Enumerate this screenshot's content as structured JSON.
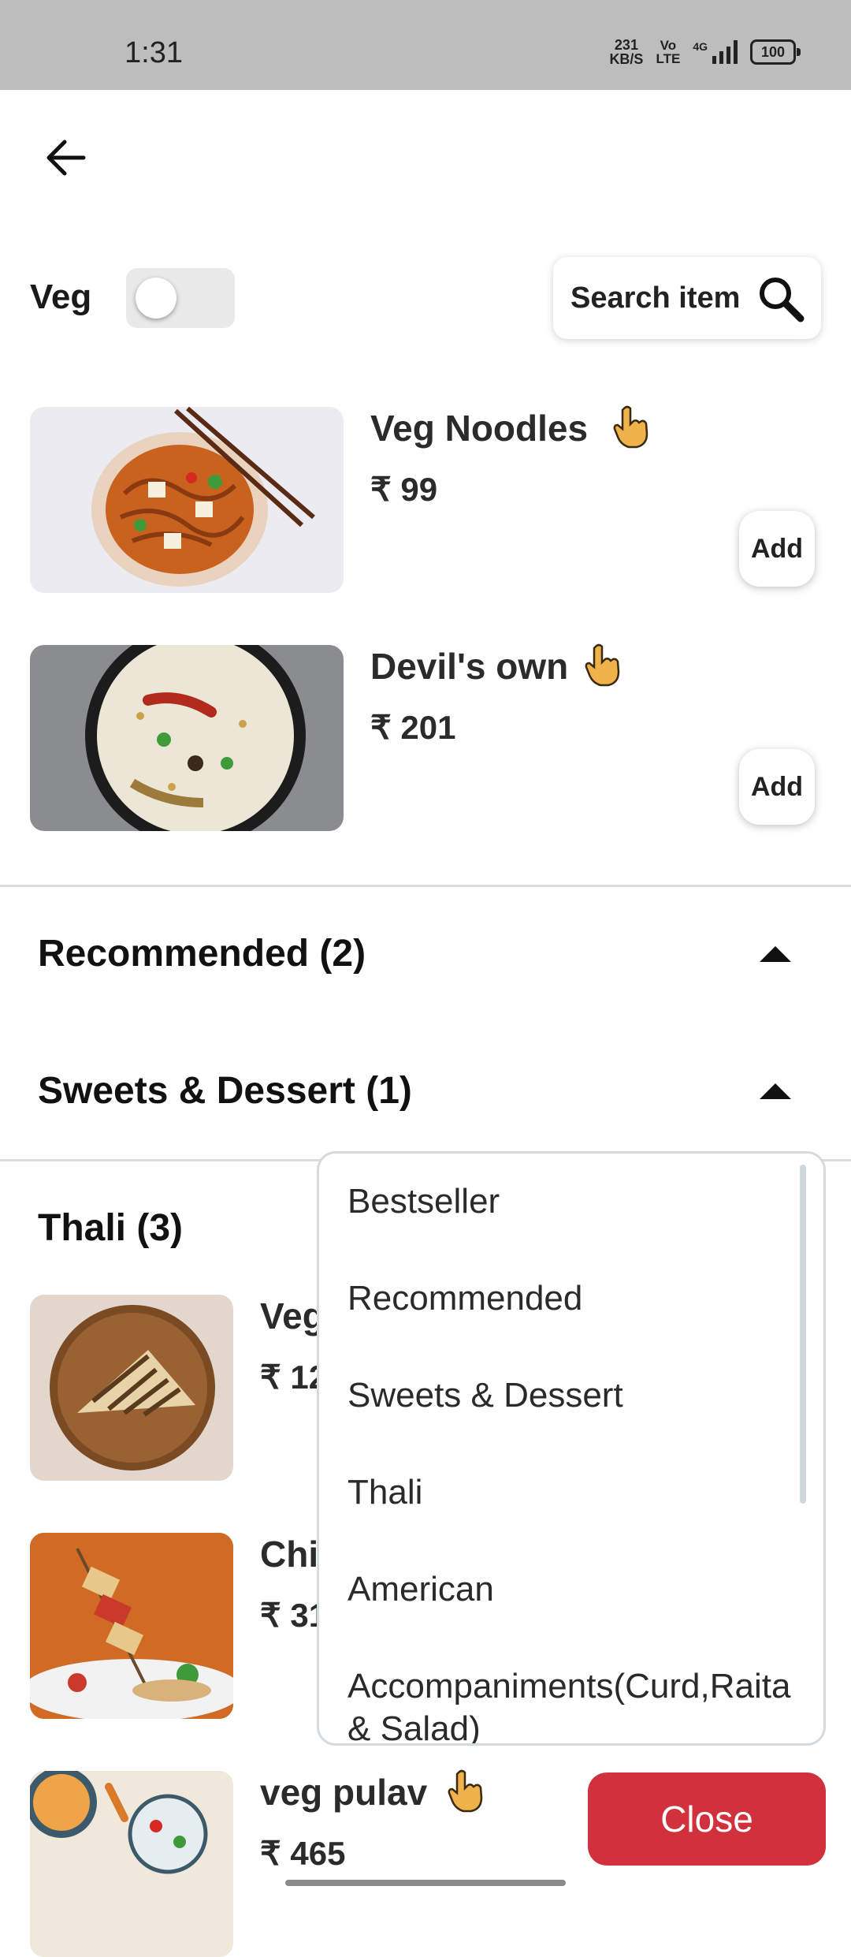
{
  "status_bar": {
    "time": "1:31",
    "net_speed_value": "231",
    "net_speed_unit": "KB/S",
    "volte_top": "Vo",
    "volte_bottom": "LTE",
    "network": "4G",
    "battery": "100"
  },
  "filter": {
    "veg_label": "Veg",
    "veg_toggle_on": false,
    "search_label": "Search item"
  },
  "items": [
    {
      "name": "Veg Noodles",
      "price": "₹ 99",
      "add_label": "Add"
    },
    {
      "name": "Devil's own",
      "price": "₹ 201",
      "add_label": "Add"
    }
  ],
  "sections": [
    {
      "title": "Recommended (2)"
    },
    {
      "title": "Sweets & Dessert (1)"
    },
    {
      "title": "Thali (3)"
    }
  ],
  "thali_items": [
    {
      "name_partial": "Veg",
      "price_partial": "₹ 12"
    },
    {
      "name_partial": "Chi",
      "price_partial": "₹ 31"
    },
    {
      "name": "veg pulav",
      "price": "₹ 465"
    }
  ],
  "dropdown": {
    "options": [
      "Bestseller",
      "Recommended",
      "Sweets & Dessert",
      "Thali",
      "American",
      "Accompaniments(Curd,Raita & Salad)"
    ]
  },
  "close_label": "Close",
  "colors": {
    "status_bar_bg": "#bdbdbd",
    "close_button": "#d1313d",
    "hand_icon": "#f0b24a"
  }
}
